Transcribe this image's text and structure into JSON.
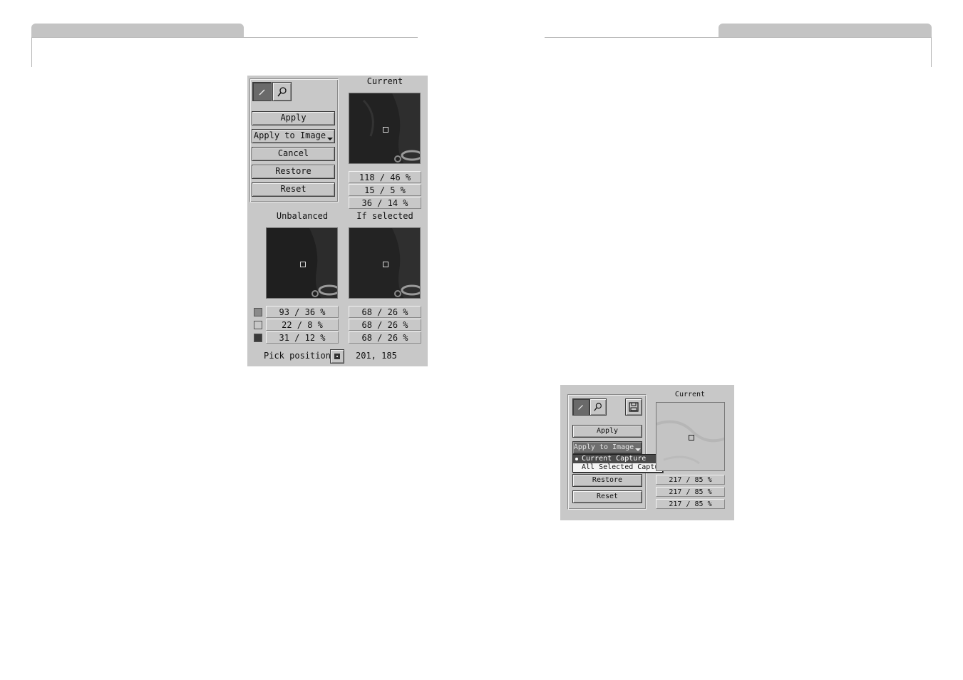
{
  "left_panel": {
    "tools": [
      {
        "icon": "eyedropper-icon",
        "active": true
      },
      {
        "icon": "magnifier-icon",
        "active": false
      }
    ],
    "buttons": {
      "apply": "Apply",
      "apply_to_image": "Apply to Image",
      "cancel": "Cancel",
      "restore": "Restore",
      "reset": "Reset"
    },
    "current_label": "Current",
    "current_values": [
      "118 / 46 %",
      "15 / 5 %",
      "36 / 14 %"
    ],
    "unbalanced_label": "Unbalanced",
    "if_selected_label": "If selected",
    "unbalanced_values": [
      "93 / 36 %",
      "22 / 8 %",
      "31 / 12 %"
    ],
    "if_selected_values": [
      "68 / 26 %",
      "68 / 26 %",
      "68 / 26 %"
    ],
    "channel_colors": [
      "#8a8a8a",
      "#c8c8c8",
      "#3a3a3a"
    ],
    "pick_position_label": "Pick position:",
    "pick_position_value": "201, 185"
  },
  "right_panel": {
    "tools": [
      {
        "icon": "eyedropper-icon",
        "active": true
      },
      {
        "icon": "magnifier-icon",
        "active": false
      }
    ],
    "save_icon": "floppy-disk-icon",
    "buttons": {
      "apply": "Apply",
      "apply_to_image": "Apply to Image",
      "restore": "Restore",
      "reset": "Reset"
    },
    "menu_items": [
      "Current Capture",
      "All Selected Captures"
    ],
    "selected_menu_item": "Current Capture",
    "current_label": "Current",
    "current_values": [
      "217 / 85 %",
      "217 / 85 %",
      "217 / 85 %"
    ]
  }
}
